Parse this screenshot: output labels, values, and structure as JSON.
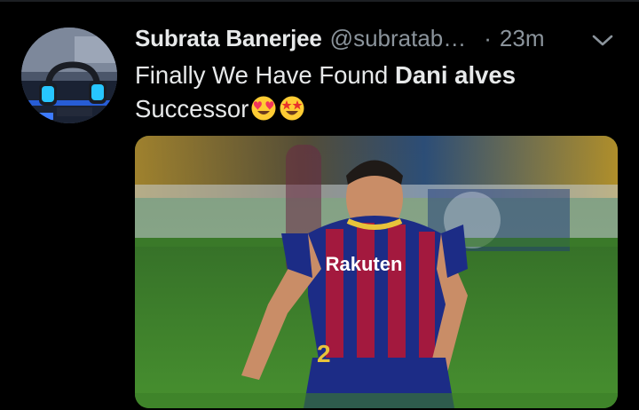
{
  "tweet": {
    "author_name": "Subrata Banerjee",
    "handle": "@subratab…",
    "separator": "·",
    "timestamp": "23m",
    "text_part1": "Finally We Have Found ",
    "text_bold": "Dani alves",
    "text_part2": "Successor",
    "emojis": [
      "smiling-face-with-heart-eyes",
      "star-struck"
    ],
    "media_alt": "Football player in a blue and red striped kit dribbling on a pitch",
    "media_texts": {
      "sponsor": "Rakuten",
      "kit_number": "2"
    }
  },
  "colors": {
    "background": "#000000",
    "primary_text": "#e7e9ea",
    "secondary_text": "#8b949c"
  }
}
